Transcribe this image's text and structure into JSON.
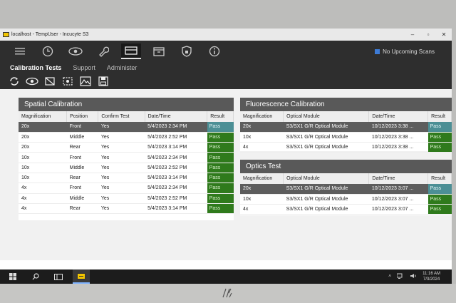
{
  "window": {
    "title": "localhost - TempUser - Incucyte S3"
  },
  "status": {
    "scans_text": "No Upcoming Scans"
  },
  "tabs": [
    "Calibration Tests",
    "Support",
    "Administer"
  ],
  "spatial": {
    "title": "Spatial Calibration",
    "headers": [
      "Magnification",
      "Position",
      "Confirm Test",
      "Date/Time",
      "Result"
    ],
    "rows": [
      [
        "20x",
        "Front",
        "Yes",
        "5/4/2023 2:34 PM",
        "Pass"
      ],
      [
        "20x",
        "Middle",
        "Yes",
        "5/4/2023 2:52 PM",
        "Pass"
      ],
      [
        "20x",
        "Rear",
        "Yes",
        "5/4/2023 3:14 PM",
        "Pass"
      ],
      [
        "10x",
        "Front",
        "Yes",
        "5/4/2023 2:34 PM",
        "Pass"
      ],
      [
        "10x",
        "Middle",
        "Yes",
        "5/4/2023 2:52 PM",
        "Pass"
      ],
      [
        "10x",
        "Rear",
        "Yes",
        "5/4/2023 3:14 PM",
        "Pass"
      ],
      [
        "4x",
        "Front",
        "Yes",
        "5/4/2023 2:34 PM",
        "Pass"
      ],
      [
        "4x",
        "Middle",
        "Yes",
        "5/4/2023 2:52 PM",
        "Pass"
      ],
      [
        "4x",
        "Rear",
        "Yes",
        "5/4/2023 3:14 PM",
        "Pass"
      ]
    ]
  },
  "fluorescence": {
    "title": "Fluorescence Calibration",
    "headers": [
      "Magnification",
      "Optical Module",
      "Date/Time",
      "Result"
    ],
    "rows": [
      [
        "20x",
        "S3/SX1 G/R Optical Module",
        "10/12/2023 3:38 ...",
        "Pass"
      ],
      [
        "10x",
        "S3/SX1 G/R Optical Module",
        "10/12/2023 3:38 ...",
        "Pass"
      ],
      [
        "4x",
        "S3/SX1 G/R Optical Module",
        "10/12/2023 3:38 ...",
        "Pass"
      ]
    ]
  },
  "optics": {
    "title": "Optics Test",
    "headers": [
      "Magnification",
      "Optical Module",
      "Date/Time",
      "Result"
    ],
    "rows": [
      [
        "20x",
        "S3/SX1 G/R Optical Module",
        "10/12/2023 3:07 ...",
        "Pass"
      ],
      [
        "10x",
        "S3/SX1 G/R Optical Module",
        "10/12/2023 3:07 ...",
        "Pass"
      ],
      [
        "4x",
        "S3/SX1 G/R Optical Module",
        "10/12/2023 3:07 ...",
        "Pass"
      ]
    ]
  },
  "taskbar": {
    "time": "11:16 AM",
    "date": "7/3/2024"
  },
  "colors": {
    "pass_green": "#2f7a1c",
    "selected_pass": "#4c8f95",
    "app_dark": "#2e2e2e"
  }
}
